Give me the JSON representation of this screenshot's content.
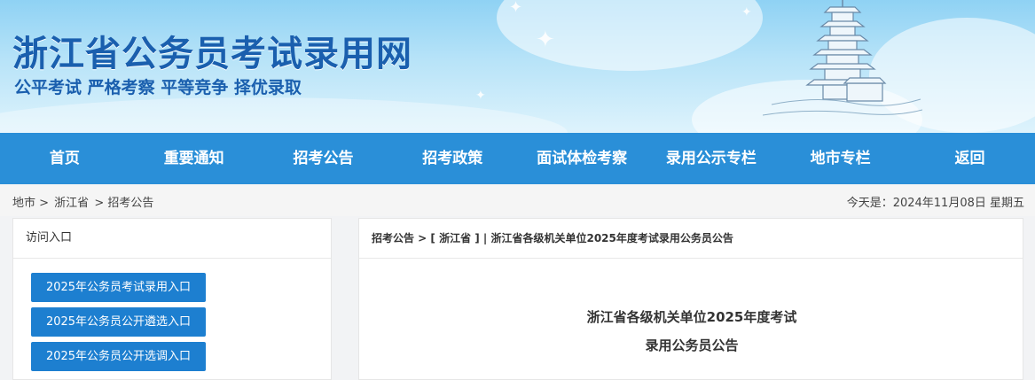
{
  "header": {
    "site_title": "浙江省公务员考试录用网",
    "slogan": "公平考试 严格考察 平等竞争 择优录取"
  },
  "nav": {
    "items": [
      {
        "label": "首页"
      },
      {
        "label": "重要通知"
      },
      {
        "label": "招考公告"
      },
      {
        "label": "招考政策"
      },
      {
        "label": "面试体检考察"
      },
      {
        "label": "录用公示专栏"
      },
      {
        "label": "地市专栏"
      },
      {
        "label": "返回"
      }
    ]
  },
  "breadcrumb": {
    "items": [
      {
        "label": "地市 >"
      },
      {
        "label": "浙江省"
      },
      {
        "label": "> 招考公告"
      }
    ]
  },
  "date_line": "今天是：2024年11月08日 星期五",
  "sidebar": {
    "title": "访问入口",
    "buttons": [
      {
        "label": "2025年公务员考试录用入口"
      },
      {
        "label": "2025年公务员公开遴选入口"
      },
      {
        "label": "2025年公务员公开选调入口"
      }
    ]
  },
  "article": {
    "path": "招考公告 > [ 浙江省 ] | 浙江省各级机关单位2025年度考试录用公务员公告",
    "title_line1": "浙江省各级机关单位2025年度考试",
    "title_line2": "录用公务员公告"
  },
  "colors": {
    "nav_bg": "#2a8fd8",
    "title_blue": "#1a5fae",
    "button_bg": "#1d7fd0"
  }
}
